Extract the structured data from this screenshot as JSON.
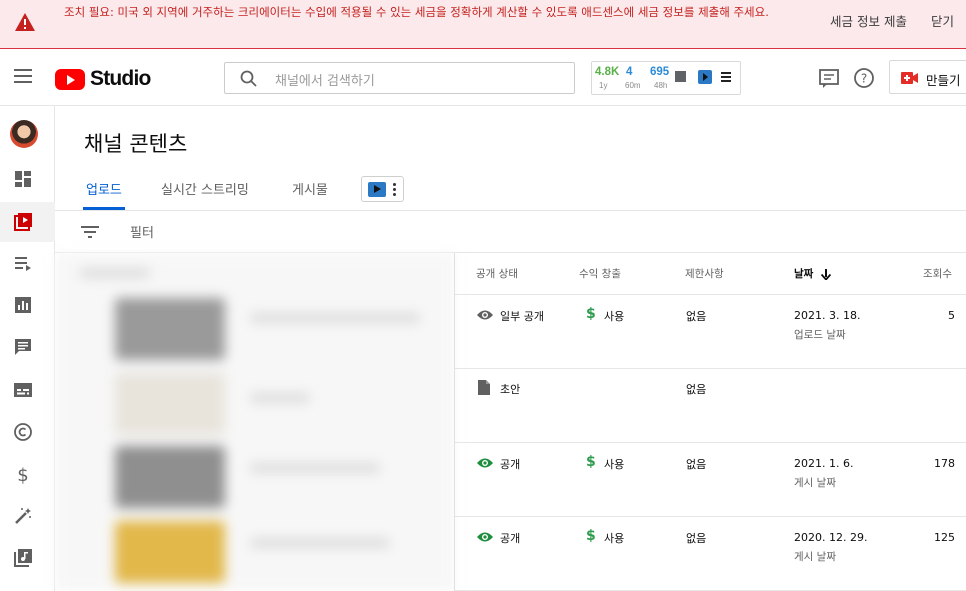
{
  "banner": {
    "message": "조치 필요: 미국 외 지역에 거주하는 크리에이터는 수입에 적용될 수 있는 세금을 정확하게 계산할 수 있도록 애드센스에 세금 정보를 제출해 주세요.",
    "submit_label": "세금 정보 제출",
    "close_label": "닫기",
    "accent_color": "#c5221f"
  },
  "header": {
    "logo_text": "Studio",
    "search_placeholder": "채널에서 검색하기",
    "extension": {
      "views": "4.8K",
      "views_period": "1y",
      "realtime": "4",
      "realtime_period": "60m",
      "recent": "695",
      "recent_period": "48h"
    },
    "create_label": "만들기"
  },
  "sidebar": {
    "items": [
      "dashboard-icon",
      "content-icon",
      "playlists-icon",
      "analytics-icon",
      "comments-icon",
      "subtitles-icon",
      "copyright-icon",
      "monetization-icon",
      "customization-icon",
      "audio-library-icon"
    ]
  },
  "main": {
    "title": "채널 콘텐츠",
    "tabs": [
      {
        "label": "업로드",
        "active": true
      },
      {
        "label": "실시간 스트리밍",
        "active": false
      },
      {
        "label": "게시물",
        "active": false
      }
    ],
    "filter_label": "필터",
    "columns": {
      "visibility": "공개 상태",
      "monetization": "수익 창출",
      "restrictions": "제한사항",
      "date": "날짜",
      "views": "조회수"
    },
    "rows": [
      {
        "visibility": "일부 공개",
        "visibility_icon": "eye-icon",
        "visibility_color": "#606060",
        "monetization": "사용",
        "restrictions": "없음",
        "date": "2021. 3. 18.",
        "date_label": "업로드 날짜",
        "views": "5"
      },
      {
        "visibility": "초안",
        "visibility_icon": "draft-icon",
        "visibility_color": "#606060",
        "monetization": "",
        "restrictions": "없음",
        "date": "",
        "date_label": "",
        "views": ""
      },
      {
        "visibility": "공개",
        "visibility_icon": "eye-icon",
        "visibility_color": "#1e8e3e",
        "monetization": "사용",
        "restrictions": "없음",
        "date": "2021. 1. 6.",
        "date_label": "게시 날짜",
        "views": "178"
      },
      {
        "visibility": "공개",
        "visibility_icon": "eye-icon",
        "visibility_color": "#1e8e3e",
        "monetization": "사용",
        "restrictions": "없음",
        "date": "2020. 12. 29.",
        "date_label": "게시 날짜",
        "views": "125"
      }
    ]
  }
}
